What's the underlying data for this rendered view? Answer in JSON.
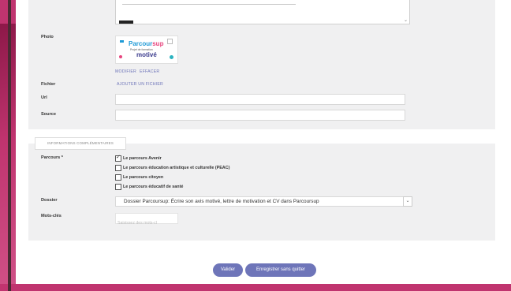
{
  "form": {
    "photo_label": "Photo",
    "photo_brand_main": "Parcour",
    "photo_brand_accent": "sup",
    "photo_subtitle": "Projet de formation",
    "photo_title": "motivé",
    "photo_actions": {
      "modify": "MODIFIER",
      "delete": "EFFACER"
    },
    "file_label": "Fichier",
    "file_action": "AJOUTER UN FICHIER",
    "url_label": "Url",
    "source_label": "Source"
  },
  "additional": {
    "section_title": "INFORMATIONS COMPLÉMENTAIRES",
    "parcours_label": "Parcours *",
    "parcours_options": [
      {
        "label": "Le parcours Avenir",
        "checked": true
      },
      {
        "label": "Le parcours éducation artistique et culturelle (PEAC)",
        "checked": false
      },
      {
        "label": "Le parcours citoyen",
        "checked": false
      },
      {
        "label": "Le parcours éducatif de santé",
        "checked": false
      }
    ],
    "dossier_label": "Dossier",
    "dossier_value": "Dossier Parcoursup: Écrire son avis motivé, lettre de motivation et CV dans Parcoursup",
    "keywords_label": "Mots-clés",
    "keywords_placeholder": "Saisissez des mots-cl"
  },
  "actions": {
    "validate": "Valider",
    "save_no_quit": "Enregistrer sans quitter"
  },
  "icons": {
    "checked": "check-icon",
    "dropdown": "chevron-down-icon"
  },
  "colors": {
    "accent": "#6e75b9",
    "brand": "#c0346f",
    "parcoursup_blue": "#1f9ad6",
    "parcoursup_pink": "#e7457e"
  }
}
